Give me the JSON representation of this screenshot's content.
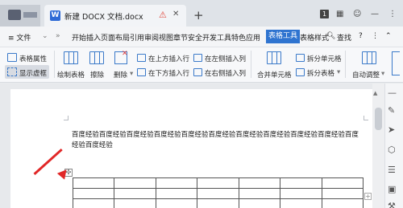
{
  "titlebar": {
    "doc_tab_icon": "W",
    "doc_title": "新建 DOCX 文档.docx",
    "warn_icon": "⚠",
    "close_icon": "✕",
    "add_icon": "+",
    "badge": "1"
  },
  "menubar": {
    "menu_label": "≡ 文件",
    "expand": "»",
    "tabs_text": "开始插入页面布局引用审阅视图章节安全开发工具特色应用",
    "active_tab": "表格工具",
    "style_tab": "表格样式",
    "search_label": "查找",
    "help": "?"
  },
  "ribbon": {
    "table_props": "表格属性",
    "show_grid": "显示虚框",
    "draw_table": "绘制表格",
    "erase": "擦除",
    "delete": "删除",
    "insert_above": "在上方插入行",
    "insert_below": "在下方插入行",
    "insert_left": "在左侧插入列",
    "insert_right": "在右侧插入列",
    "merge": "合并单元格",
    "split_cell": "拆分单元格",
    "split_table": "拆分表格",
    "auto_fit": "自动调整"
  },
  "document": {
    "paragraph": "百度经验百度经验百度经验百度经验百度经验百度经验百度经验百度经验百度经验百度经验百度经验百度经验"
  },
  "table": {
    "rows": 3,
    "cols": 7,
    "move_handle": "✣",
    "add_row": "+"
  },
  "colors": {
    "accent": "#2f74d0",
    "arrow": "#e12727"
  }
}
